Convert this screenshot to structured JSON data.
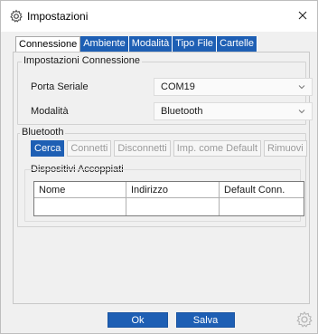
{
  "window": {
    "title": "Impostazioni"
  },
  "tabs": [
    {
      "label": "Connessione",
      "active": true
    },
    {
      "label": "Ambiente"
    },
    {
      "label": "Modalità"
    },
    {
      "label": "Tipo File"
    },
    {
      "label": "Cartelle"
    }
  ],
  "connection_group": {
    "legend": "Impostazioni Connessione",
    "serial_port_label": "Porta Seriale",
    "serial_port_value": "COM19",
    "mode_label": "Modalità",
    "mode_value": "Bluetooth"
  },
  "bluetooth_group": {
    "legend": "Bluetooth",
    "buttons": {
      "search": "Cerca",
      "connect": "Connetti",
      "disconnect": "Disconnetti",
      "set_default": "Imp. come Default",
      "remove": "Rimuovi"
    },
    "paired_label": "Dispositivi Accoppiati",
    "table": {
      "columns": [
        "Nome",
        "Indirizzo",
        "Default Conn."
      ]
    }
  },
  "footer": {
    "ok_label": "Ok",
    "save_label": "Salva"
  },
  "colors": {
    "accent": "#1e5fb4",
    "window_bg": "#f0f0f0"
  },
  "icons": {
    "title": "gear-icon",
    "close": "close-icon",
    "dropdown": "chevron-down-icon",
    "corner": "gear-icon"
  }
}
